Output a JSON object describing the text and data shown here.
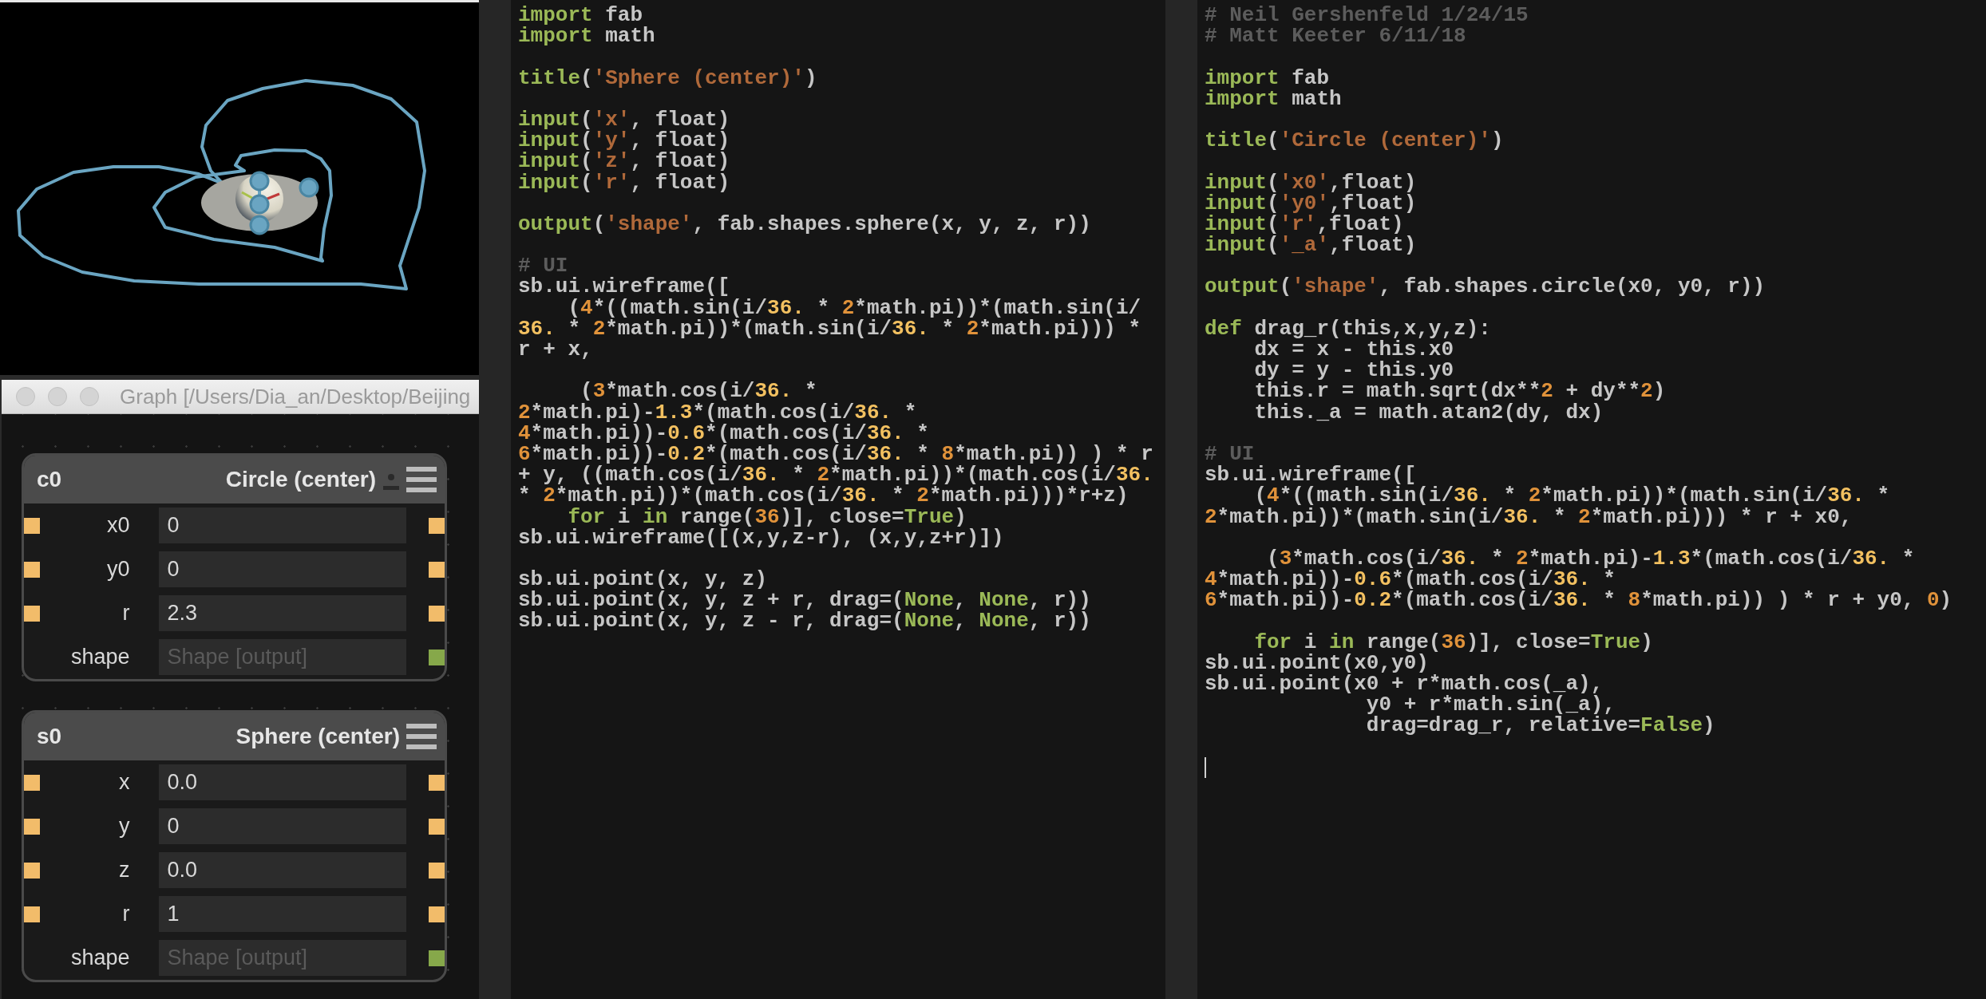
{
  "graph_window": {
    "title": "Graph [/Users/Dia_an/Desktop/Beijing",
    "nodes": [
      {
        "name": "c0",
        "title": "Circle (center)",
        "pin_icon": true,
        "rows": [
          {
            "label": "x0",
            "value": "0",
            "kind": "input"
          },
          {
            "label": "y0",
            "value": "0",
            "kind": "input"
          },
          {
            "label": "r",
            "value": "2.3",
            "kind": "input"
          },
          {
            "label": "shape",
            "placeholder": "Shape [output]",
            "kind": "output"
          }
        ]
      },
      {
        "name": "s0",
        "title": "Sphere (center)",
        "pin_icon": false,
        "rows": [
          {
            "label": "x",
            "value": "0.0",
            "kind": "input"
          },
          {
            "label": "y",
            "value": "0",
            "kind": "input"
          },
          {
            "label": "z",
            "value": "0.0",
            "kind": "input"
          },
          {
            "label": "r",
            "value": "1",
            "kind": "input"
          },
          {
            "label": "shape",
            "placeholder": "Shape [output]",
            "kind": "output"
          }
        ]
      }
    ]
  },
  "editors": [
    {
      "cursor_line": false,
      "lines": [
        {
          "tokens": [
            {
              "kind": "keyword",
              "text": "import"
            },
            " fab"
          ]
        },
        {
          "tokens": [
            {
              "kind": "keyword",
              "text": "import"
            },
            " math"
          ]
        },
        {
          "gap_before": true,
          "tokens": [
            {
              "kind": "keyword",
              "text": "title"
            },
            "(",
            {
              "kind": "string",
              "text": "'Sphere (center)'"
            },
            ")"
          ]
        },
        {
          "gap_before": true,
          "tokens": [
            {
              "kind": "keyword",
              "text": "input"
            },
            "(",
            {
              "kind": "string",
              "text": "'x'"
            },
            ", float)"
          ]
        },
        {
          "tokens": [
            {
              "kind": "keyword",
              "text": "input"
            },
            "(",
            {
              "kind": "string",
              "text": "'y'"
            },
            ", float)"
          ]
        },
        {
          "tokens": [
            {
              "kind": "keyword",
              "text": "input"
            },
            "(",
            {
              "kind": "string",
              "text": "'z'"
            },
            ", float)"
          ]
        },
        {
          "tokens": [
            {
              "kind": "keyword",
              "text": "input"
            },
            "(",
            {
              "kind": "string",
              "text": "'r'"
            },
            ", float)"
          ]
        },
        {
          "gap_before": true,
          "tokens": [
            {
              "kind": "keyword",
              "text": "output"
            },
            "(",
            {
              "kind": "string",
              "text": "'shape'"
            },
            ", fab.shapes.sphere(x, y, z, r))"
          ]
        },
        {
          "gap_before": true,
          "tokens": [
            {
              "kind": "comment",
              "text": "# UI"
            }
          ]
        },
        {
          "tokens": [
            "sb.ui.wireframe(["
          ]
        },
        {
          "tokens": [
            "    (",
            {
              "kind": "int",
              "text": "4"
            },
            "*((math.sin(i/",
            {
              "kind": "float",
              "text": "36."
            },
            " * ",
            {
              "kind": "int",
              "text": "2"
            },
            "*math.pi))*(math.sin(i/"
          ]
        },
        {
          "tokens": [
            {
              "kind": "float",
              "text": "36."
            },
            " * ",
            {
              "kind": "int",
              "text": "2"
            },
            "*math.pi))*(math.sin(i/",
            {
              "kind": "float",
              "text": "36."
            },
            " * ",
            {
              "kind": "int",
              "text": "2"
            },
            "*math.pi))) *"
          ]
        },
        {
          "tokens": [
            "r + x,"
          ]
        },
        {
          "gap_before": true,
          "tokens": [
            "     (",
            {
              "kind": "int",
              "text": "3"
            },
            "*math.cos(i/",
            {
              "kind": "float",
              "text": "36."
            },
            " *"
          ]
        },
        {
          "tokens": [
            {
              "kind": "int",
              "text": "2"
            },
            "*math.pi)-",
            {
              "kind": "float",
              "text": "1.3"
            },
            "*(math.cos(i/",
            {
              "kind": "float",
              "text": "36."
            },
            " *"
          ]
        },
        {
          "tokens": [
            {
              "kind": "int",
              "text": "4"
            },
            "*math.pi))-",
            {
              "kind": "float",
              "text": "0.6"
            },
            "*(math.cos(i/",
            {
              "kind": "float",
              "text": "36."
            },
            " *"
          ]
        },
        {
          "tokens": [
            {
              "kind": "int",
              "text": "6"
            },
            "*math.pi))-",
            {
              "kind": "float",
              "text": "0.2"
            },
            "*(math.cos(i/",
            {
              "kind": "float",
              "text": "36."
            },
            " * ",
            {
              "kind": "int",
              "text": "8"
            },
            "*math.pi)) ) * r"
          ]
        },
        {
          "tokens": [
            "+ y, ((math.cos(i/",
            {
              "kind": "float",
              "text": "36."
            },
            " * ",
            {
              "kind": "int",
              "text": "2"
            },
            "*math.pi))*(math.cos(i/",
            {
              "kind": "float",
              "text": "36."
            }
          ]
        },
        {
          "tokens": [
            "* ",
            {
              "kind": "int",
              "text": "2"
            },
            "*math.pi))*(math.cos(i/",
            {
              "kind": "float",
              "text": "36."
            },
            " * ",
            {
              "kind": "int",
              "text": "2"
            },
            "*math.pi)))*r+z)"
          ]
        },
        {
          "tokens": [
            {
              "kind": "keyword",
              "text": "    for"
            },
            " i ",
            {
              "kind": "keyword",
              "text": "in"
            },
            " range(",
            {
              "kind": "int",
              "text": "36"
            },
            ")], close=",
            {
              "kind": "keyword",
              "text": "True"
            },
            ")"
          ]
        },
        {
          "tokens": [
            "sb.ui.wireframe([(x,y,z-r), (x,y,z+r)])"
          ]
        },
        {
          "gap_before": true,
          "tokens": [
            "sb.ui.point(x, y, z)"
          ]
        },
        {
          "tokens": [
            "sb.ui.point(x, y, z + r, drag=(",
            {
              "kind": "keyword",
              "text": "None"
            },
            ", ",
            {
              "kind": "keyword",
              "text": "None"
            },
            ", r))"
          ]
        },
        {
          "tokens": [
            "sb.ui.point(x, y, z - r, drag=(",
            {
              "kind": "keyword",
              "text": "None"
            },
            ", ",
            {
              "kind": "keyword",
              "text": "None"
            },
            ", r))"
          ]
        }
      ]
    },
    {
      "cursor_line": true,
      "lines": [
        {
          "tokens": [
            {
              "kind": "comment",
              "text": "# Neil Gershenfeld 1/24/15"
            }
          ]
        },
        {
          "tokens": [
            {
              "kind": "comment",
              "text": "# Matt Keeter 6/11/18"
            }
          ]
        },
        {
          "gap_before": true,
          "tokens": [
            {
              "kind": "keyword",
              "text": "import"
            },
            " fab"
          ]
        },
        {
          "tokens": [
            {
              "kind": "keyword",
              "text": "import"
            },
            " math"
          ]
        },
        {
          "gap_before": true,
          "tokens": [
            {
              "kind": "keyword",
              "text": "title"
            },
            "(",
            {
              "kind": "string",
              "text": "'Circle (center)'"
            },
            ")"
          ]
        },
        {
          "gap_before": true,
          "tokens": [
            {
              "kind": "keyword",
              "text": "input"
            },
            "(",
            {
              "kind": "string",
              "text": "'x0'"
            },
            ",float)"
          ]
        },
        {
          "tokens": [
            {
              "kind": "keyword",
              "text": "input"
            },
            "(",
            {
              "kind": "string",
              "text": "'y0'"
            },
            ",float)"
          ]
        },
        {
          "tokens": [
            {
              "kind": "keyword",
              "text": "input"
            },
            "(",
            {
              "kind": "string",
              "text": "'r'"
            },
            ",float)"
          ]
        },
        {
          "tokens": [
            {
              "kind": "keyword",
              "text": "input"
            },
            "(",
            {
              "kind": "string",
              "text": "'_a'"
            },
            ",float)"
          ]
        },
        {
          "gap_before": true,
          "tokens": [
            {
              "kind": "keyword",
              "text": "output"
            },
            "(",
            {
              "kind": "string",
              "text": "'shape'"
            },
            ", fab.shapes.circle(x0, y0, r))"
          ]
        },
        {
          "gap_before": true,
          "tokens": [
            {
              "kind": "keyword",
              "text": "def"
            },
            " drag_r(this,x,y,z):"
          ]
        },
        {
          "tokens": [
            "    dx = x - this.x0"
          ]
        },
        {
          "tokens": [
            "    dy = y - this.y0"
          ]
        },
        {
          "tokens": [
            "    this.r = math.sqrt(dx**",
            {
              "kind": "int",
              "text": "2"
            },
            " + dy**",
            {
              "kind": "int",
              "text": "2"
            },
            ")"
          ]
        },
        {
          "tokens": [
            "    this._a = math.atan2(dy, dx)"
          ]
        },
        {
          "gap_before": true,
          "tokens": [
            {
              "kind": "comment",
              "text": "# UI"
            }
          ]
        },
        {
          "tokens": [
            "sb.ui.wireframe(["
          ]
        },
        {
          "tokens": [
            "    (",
            {
              "kind": "int",
              "text": "4"
            },
            "*((math.sin(i/",
            {
              "kind": "float",
              "text": "36."
            },
            " * ",
            {
              "kind": "int",
              "text": "2"
            },
            "*math.pi))*(math.sin(i/",
            {
              "kind": "float",
              "text": "36."
            },
            " *"
          ]
        },
        {
          "tokens": [
            {
              "kind": "int",
              "text": "2"
            },
            "*math.pi))*(math.sin(i/",
            {
              "kind": "float",
              "text": "36."
            },
            " * ",
            {
              "kind": "int",
              "text": "2"
            },
            "*math.pi))) * r + x0,"
          ]
        },
        {
          "gap_before": true,
          "tokens": [
            "     (",
            {
              "kind": "int",
              "text": "3"
            },
            "*math.cos(i/",
            {
              "kind": "float",
              "text": "36."
            },
            " * ",
            {
              "kind": "int",
              "text": "2"
            },
            "*math.pi)-",
            {
              "kind": "float",
              "text": "1.3"
            },
            "*(math.cos(i/",
            {
              "kind": "float",
              "text": "36."
            },
            " *"
          ]
        },
        {
          "tokens": [
            {
              "kind": "int",
              "text": "4"
            },
            "*math.pi))-",
            {
              "kind": "float",
              "text": "0.6"
            },
            "*(math.cos(i/",
            {
              "kind": "float",
              "text": "36."
            },
            " *"
          ]
        },
        {
          "tokens": [
            {
              "kind": "int",
              "text": "6"
            },
            "*math.pi))-",
            {
              "kind": "float",
              "text": "0.2"
            },
            "*(math.cos(i/",
            {
              "kind": "float",
              "text": "36."
            },
            " * ",
            {
              "kind": "int",
              "text": "8"
            },
            "*math.pi)) ) * r + y0, ",
            {
              "kind": "int",
              "text": "0"
            },
            ")"
          ]
        },
        {
          "gap_before": true,
          "tokens": [
            {
              "kind": "keyword",
              "text": "    for"
            },
            " i ",
            {
              "kind": "keyword",
              "text": "in"
            },
            " range(",
            {
              "kind": "int",
              "text": "36"
            },
            ")], close=",
            {
              "kind": "keyword",
              "text": "True"
            },
            ")"
          ]
        },
        {
          "tokens": [
            "sb.ui.point(x0,y0)"
          ]
        },
        {
          "tokens": [
            "sb.ui.point(x0 + r*math.cos(_a),"
          ]
        },
        {
          "tokens": [
            "             y0 + r*math.sin(_a),"
          ]
        },
        {
          "tokens": [
            "             drag=drag_r, relative=",
            {
              "kind": "keyword",
              "text": "False"
            },
            ")"
          ]
        }
      ]
    }
  ]
}
